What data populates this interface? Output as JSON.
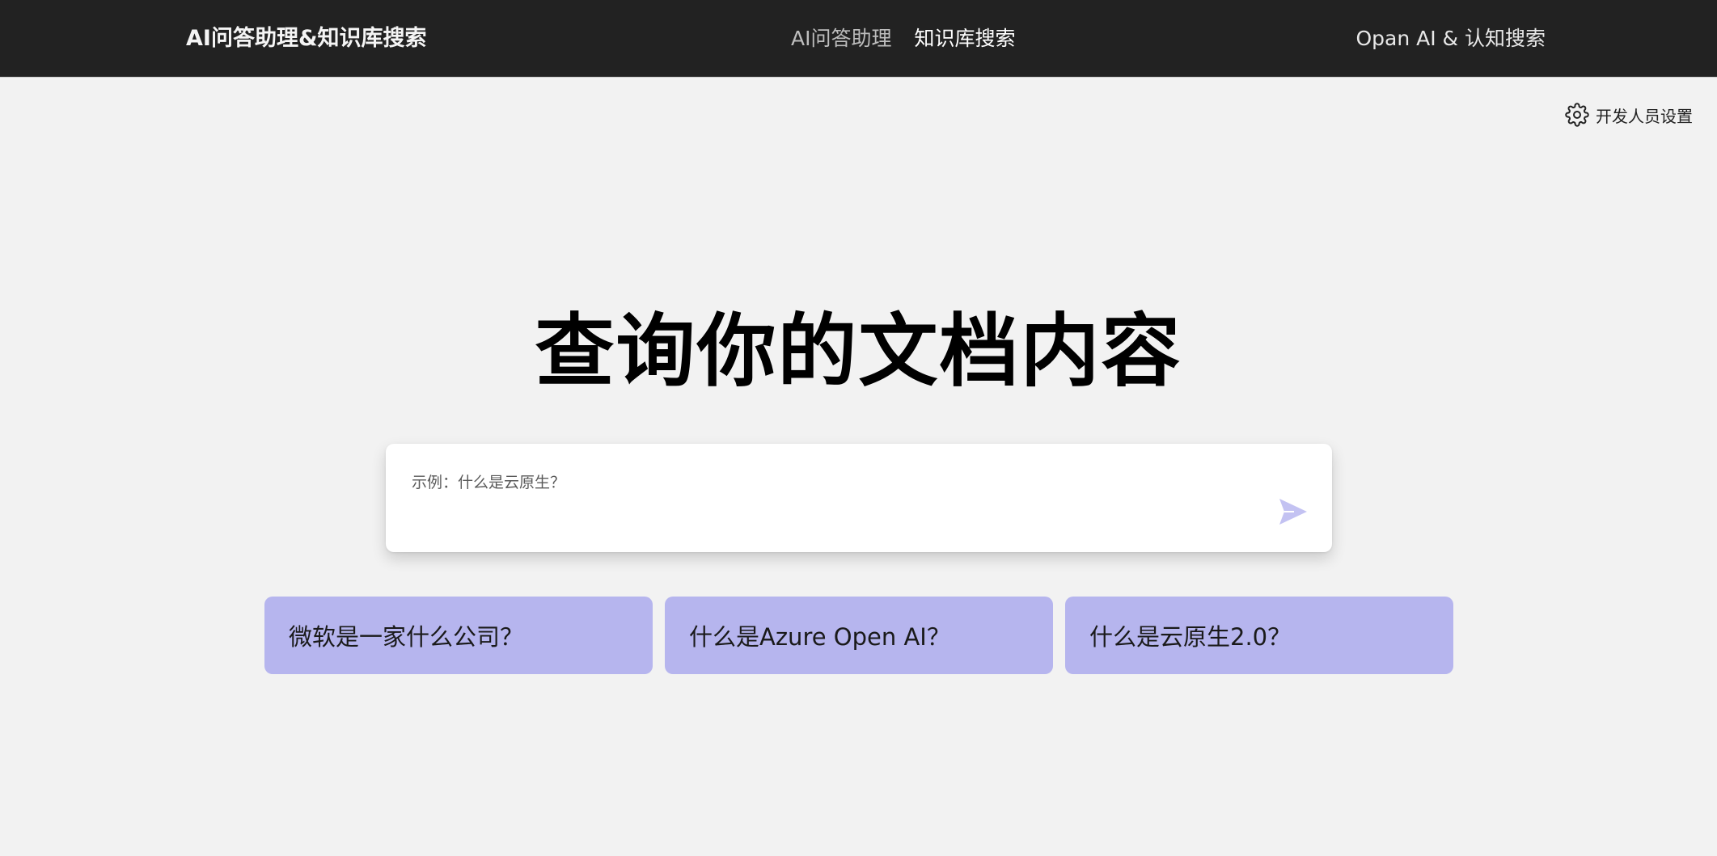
{
  "header": {
    "brand": "AI问答助理&知识库搜索",
    "nav": [
      {
        "label": "AI问答助理",
        "active": false
      },
      {
        "label": "知识库搜索",
        "active": true
      }
    ],
    "right_link": "Opan AI & 认知搜索"
  },
  "settings": {
    "icon": "gear-icon",
    "label": "开发人员设置"
  },
  "main": {
    "title": "查询你的文档内容",
    "search": {
      "placeholder": "示例：什么是云原生？",
      "value": "",
      "send_icon": "send-icon"
    },
    "examples": [
      {
        "label": "微软是一家什么公司？"
      },
      {
        "label": "什么是Azure Open AI？"
      },
      {
        "label": "什么是云原生2.0？"
      }
    ]
  },
  "colors": {
    "header_bg": "#222222",
    "page_bg": "#f2f2f2",
    "example_card_bg": "#b6b5ee",
    "send_icon": "#c3c2f2"
  }
}
